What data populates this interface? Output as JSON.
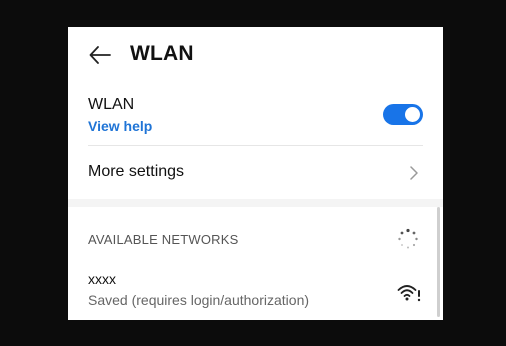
{
  "header": {
    "title": "WLAN",
    "back_icon": "arrow-left-icon"
  },
  "wlan": {
    "label": "WLAN",
    "help_link": "View help",
    "enabled": true,
    "accent": "#1874e8"
  },
  "more_settings": {
    "label": "More settings",
    "icon": "chevron-right-icon"
  },
  "available": {
    "section_label": "AVAILABLE NETWORKS",
    "scanning_icon": "loading-spinner-icon",
    "networks": [
      {
        "name": "xxxx",
        "status": "Saved (requires login/authorization)",
        "icon": "wifi-alert-icon"
      }
    ]
  }
}
